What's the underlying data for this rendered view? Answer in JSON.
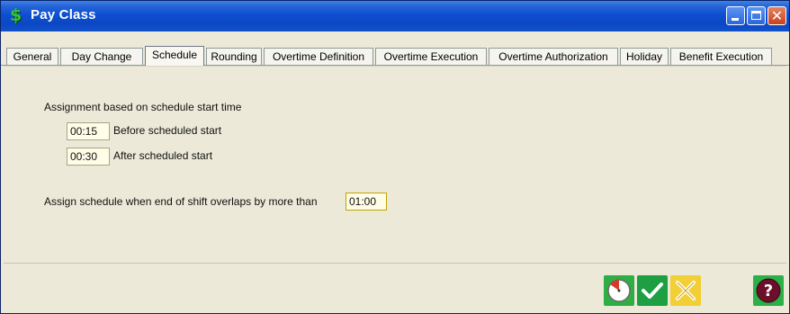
{
  "window": {
    "title": "Pay Class",
    "app_icon": "dollar-icon",
    "controls": [
      "minimize-icon",
      "maximize-icon",
      "close-icon"
    ],
    "close_glyph": "✕"
  },
  "tabs": [
    {
      "label": "General",
      "active": false
    },
    {
      "label": "Day Change",
      "active": false
    },
    {
      "label": "Schedule",
      "active": true
    },
    {
      "label": "Rounding",
      "active": false
    },
    {
      "label": "Overtime Definition",
      "active": false
    },
    {
      "label": "Overtime Execution",
      "active": false
    },
    {
      "label": "Overtime Authorization",
      "active": false
    },
    {
      "label": "Holiday",
      "active": false
    },
    {
      "label": "Benefit Execution",
      "active": false
    }
  ],
  "schedule": {
    "assignment_heading": "Assignment based on schedule start time",
    "before_value": "00:15",
    "before_label": "Before scheduled start",
    "after_value": "00:30",
    "after_label": "After scheduled start",
    "overlap_label": "Assign schedule when end of shift overlaps by more than",
    "overlap_value": "01:00"
  },
  "actions": {
    "items": [
      "timer-icon",
      "check-icon",
      "cancel-icon",
      "help-icon"
    ],
    "colors": {
      "timer": "#2fae45",
      "check": "#1e9f43",
      "cancel": "#f2cf35",
      "help": "#2bb04a"
    }
  }
}
